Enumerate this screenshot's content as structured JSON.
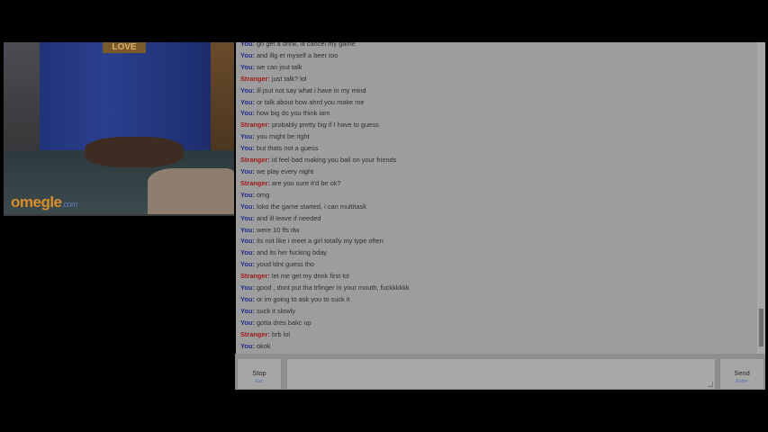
{
  "video": {
    "logo_main": "omegle",
    "logo_suffix": ".com",
    "sign_text": "LOVE"
  },
  "chat": {
    "messages": [
      {
        "speaker": "You:",
        "text": "go get a drink. ill cancel my game"
      },
      {
        "speaker": "You:",
        "text": "and illg et myself a beer too"
      },
      {
        "speaker": "You:",
        "text": "we can jsut talk"
      },
      {
        "speaker": "Stranger:",
        "text": "just talk? lol"
      },
      {
        "speaker": "You:",
        "text": "ill jsut not say what i have in my mind"
      },
      {
        "speaker": "You:",
        "text": "or talk about how ahrd you make me"
      },
      {
        "speaker": "You:",
        "text": "how big do you think iam"
      },
      {
        "speaker": "Stranger:",
        "text": "probably pretty big if I have to guess"
      },
      {
        "speaker": "You:",
        "text": "you might be right"
      },
      {
        "speaker": "You:",
        "text": "but thats not a guess"
      },
      {
        "speaker": "Stranger:",
        "text": "id feel bad making you bail on your friends"
      },
      {
        "speaker": "You:",
        "text": "we play every night"
      },
      {
        "speaker": "Stranger:",
        "text": "are you sure it'd be ok?"
      },
      {
        "speaker": "You:",
        "text": "omg"
      },
      {
        "speaker": "You:",
        "text": "loko the game started, i can multitask"
      },
      {
        "speaker": "You:",
        "text": "and ill leave if needed"
      },
      {
        "speaker": "You:",
        "text": "were 10 ffs dw"
      },
      {
        "speaker": "You:",
        "text": "its not like i meet a girl totally my type often"
      },
      {
        "speaker": "You:",
        "text": "and its her fucking bday"
      },
      {
        "speaker": "You:",
        "text": "youd ldnt guess tho"
      },
      {
        "speaker": "Stranger:",
        "text": "let me get my drink first lol"
      },
      {
        "speaker": "You:",
        "text": "good , dont put tha trfinger in your mouth, fuckkkkkk"
      },
      {
        "speaker": "You:",
        "text": "or im going to ask you to suck it"
      },
      {
        "speaker": "You:",
        "text": "suck it slowly"
      },
      {
        "speaker": "You:",
        "text": "gotta dres bakc up"
      },
      {
        "speaker": "Stranger:",
        "text": "brb lol"
      },
      {
        "speaker": "You:",
        "text": "okok"
      }
    ]
  },
  "controls": {
    "stop_label": "Stop",
    "stop_hint": "Esc",
    "send_label": "Send",
    "send_hint": "Enter",
    "message_value": ""
  },
  "colors": {
    "you": "#24318a",
    "stranger": "#9e1a1a",
    "logo": "#d98e2a"
  }
}
